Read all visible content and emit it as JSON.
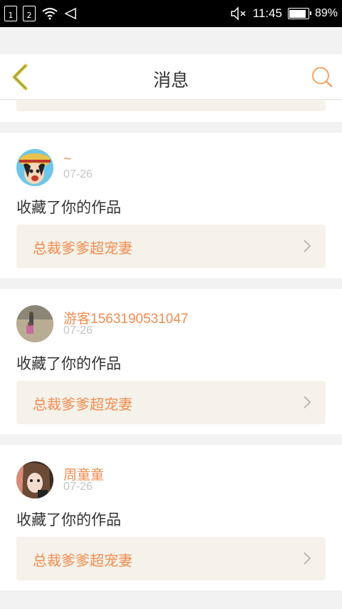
{
  "status_bar": {
    "sim1": "1",
    "sim2": "2",
    "time": "11:45",
    "battery_pct": "89%",
    "battery_level": 0.89
  },
  "header": {
    "title": "消息",
    "back_icon": "chevron-left-icon",
    "search_icon": "search-icon"
  },
  "colors": {
    "accent": "#f28c4f",
    "back_icon": "#d8cc44",
    "link_bg": "#f4f2ea"
  },
  "messages": [
    {
      "user": "~",
      "date": "07-26",
      "action": "收藏了你的作品",
      "work": "总裁爹爹超宠妻"
    },
    {
      "user": "游客1563190531047",
      "date": "07-26",
      "action": "收藏了你的作品",
      "work": "总裁爹爹超宠妻"
    },
    {
      "user": "周童童",
      "date": "07-26",
      "action": "收藏了你的作品",
      "work": "总裁爹爹超宠妻"
    }
  ]
}
